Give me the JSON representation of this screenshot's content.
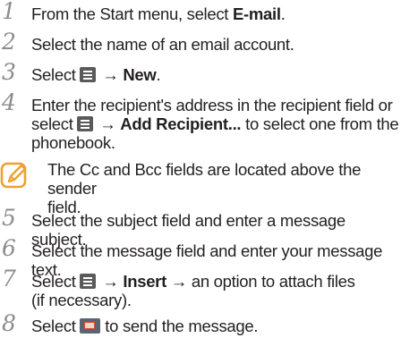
{
  "steps": [
    {
      "num": "1",
      "pre": "From the Start menu, select ",
      "bold": "E-mail",
      "post": "."
    },
    {
      "num": "2",
      "text": "Select the name of an email account."
    },
    {
      "num": "3",
      "pre": "Select ",
      "icon": "menu-icon",
      "arrow": " → ",
      "bold": "New",
      "post": "."
    },
    {
      "num": "4",
      "line1": "Enter the recipient's address in the recipient field or",
      "pre": "select ",
      "icon": "menu-icon",
      "arrow": " → ",
      "bold": "Add Recipient...",
      "post": " to select one from the",
      "line3": "phonebook."
    },
    {
      "num": "5",
      "text": "Select the subject field and enter a message subject."
    },
    {
      "num": "6",
      "text": "Select the message field and enter your message text."
    },
    {
      "num": "7",
      "pre": "Select ",
      "icon": "menu-icon",
      "arrow": " → ",
      "bold": "Insert",
      "post": " → an option to attach files",
      "line2": "(if necessary)."
    },
    {
      "num": "8",
      "pre": "Select ",
      "icon": "send-icon",
      "post": " to send the message."
    }
  ],
  "note": {
    "icon": "note-pencil-icon",
    "line1": "The Cc and Bcc fields are located above the sender",
    "line2": "field."
  }
}
